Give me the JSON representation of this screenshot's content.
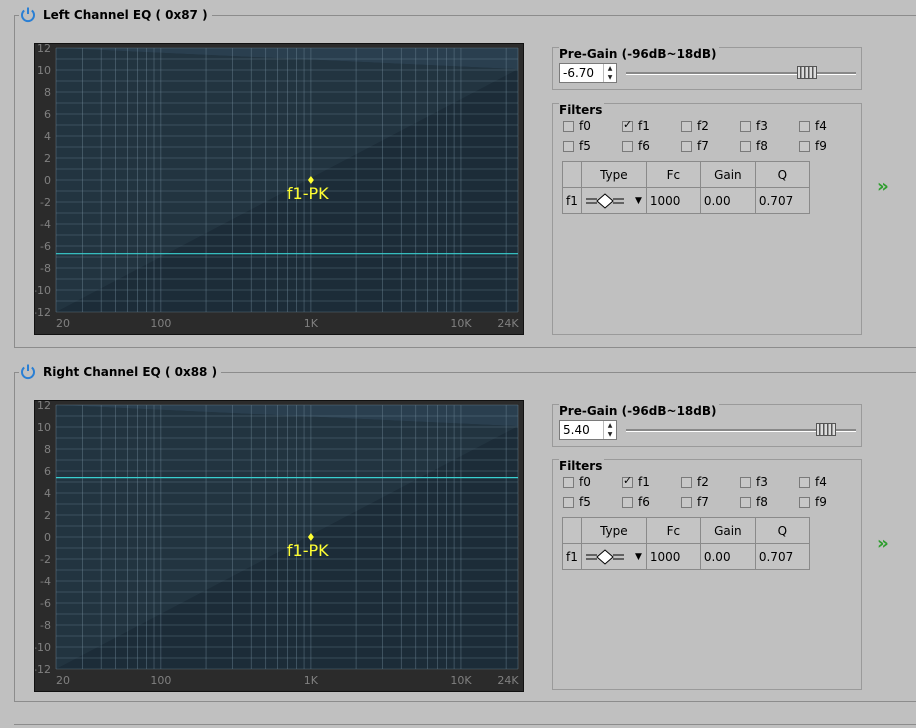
{
  "channels": [
    {
      "title": "Left Channel EQ ( 0x87 )",
      "pregain_label": "Pre-Gain (-96dB~18dB)",
      "pregain_value": "-6.70",
      "pregain_db": -6.7,
      "slider_fraction": 0.785,
      "filters_label": "Filters",
      "filter_checks": [
        {
          "label": "f0",
          "checked": false
        },
        {
          "label": "f1",
          "checked": true
        },
        {
          "label": "f2",
          "checked": false
        },
        {
          "label": "f3",
          "checked": false
        },
        {
          "label": "f4",
          "checked": false
        },
        {
          "label": "f5",
          "checked": false
        },
        {
          "label": "f6",
          "checked": false
        },
        {
          "label": "f7",
          "checked": false
        },
        {
          "label": "f8",
          "checked": false
        },
        {
          "label": "f9",
          "checked": false
        }
      ],
      "table": {
        "headers": [
          "Type",
          "Fc",
          "Gain",
          "Q"
        ],
        "row": {
          "name": "f1",
          "fc": "1000",
          "gain": "0.00",
          "q": "0.707"
        }
      },
      "marker_label": "f1-PK",
      "marker_freq": 1000,
      "marker_gain": 0
    },
    {
      "title": "Right Channel EQ ( 0x88 )",
      "pregain_label": "Pre-Gain (-96dB~18dB)",
      "pregain_value": "5.40",
      "pregain_db": 5.4,
      "slider_fraction": 0.87,
      "filters_label": "Filters",
      "filter_checks": [
        {
          "label": "f0",
          "checked": false
        },
        {
          "label": "f1",
          "checked": true
        },
        {
          "label": "f2",
          "checked": false
        },
        {
          "label": "f3",
          "checked": false
        },
        {
          "label": "f4",
          "checked": false
        },
        {
          "label": "f5",
          "checked": false
        },
        {
          "label": "f6",
          "checked": false
        },
        {
          "label": "f7",
          "checked": false
        },
        {
          "label": "f8",
          "checked": false
        },
        {
          "label": "f9",
          "checked": false
        }
      ],
      "table": {
        "headers": [
          "Type",
          "Fc",
          "Gain",
          "Q"
        ],
        "row": {
          "name": "f1",
          "fc": "1000",
          "gain": "0.00",
          "q": "0.707"
        }
      },
      "marker_label": "f1-PK",
      "marker_freq": 1000,
      "marker_gain": 0
    }
  ],
  "graph_axis": {
    "y_ticks": [
      "12",
      "10",
      "8",
      "6",
      "4",
      "2",
      "0",
      "-2",
      "-4",
      "-6",
      "-8",
      "-10",
      "-12"
    ],
    "x_ticks": [
      {
        "label": "20",
        "freq": 20
      },
      {
        "label": "100",
        "freq": 100
      },
      {
        "label": "1K",
        "freq": 1000
      },
      {
        "label": "10K",
        "freq": 10000
      },
      {
        "label": "24K",
        "freq": 24000
      }
    ],
    "y_range": [
      -12,
      12
    ],
    "x_range": [
      20,
      24000
    ],
    "x_scale": "log"
  },
  "colors": {
    "graph_bg": "#1c2c38",
    "grid": "#6f8797",
    "response_line": "#39d0d0",
    "marker": "#ffff33",
    "power_icon": "#2a7fd4",
    "next_arrows": "#2e9e2e"
  },
  "icons": {
    "power": "power-icon",
    "next": "double-chevron-right-icon",
    "filter_type": "peak-filter-icon"
  }
}
